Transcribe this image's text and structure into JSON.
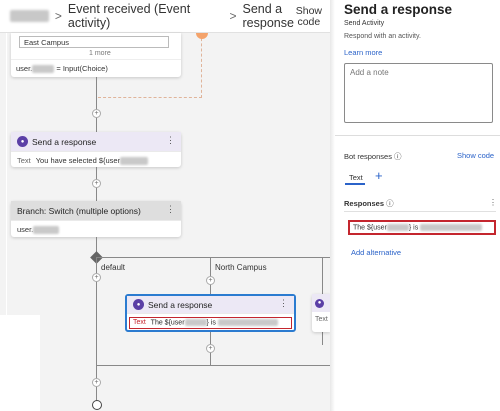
{
  "header": {
    "breadcrumb_current_dialog": "Event received (Event activity)",
    "breadcrumb_sep1": ">",
    "breadcrumb_sep2": ">",
    "breadcrumb_action": "Send a response",
    "show_code_line1": "Show",
    "show_code_line2": "code"
  },
  "canvas": {
    "choice_node": {
      "option_value": "East Campus",
      "more_label": "1 more",
      "assign_prefix": "user.",
      "assign_suffix": "= Input(Choice)"
    },
    "send_response_1": {
      "title": "Send a response",
      "menu": "⋮",
      "text_label": "Text",
      "text_value": "You have selected ${user"
    },
    "switch_node": {
      "title": "Branch: Switch (multiple options)",
      "menu": "⋮",
      "property_prefix": "user."
    },
    "branch_default": "default",
    "branch_north": "North Campus",
    "send_response_2": {
      "title": "Send a response",
      "menu": "⋮",
      "text_label": "Text",
      "text_value": "The ${user",
      "text_mid": "} is"
    },
    "partial_node": {
      "text_label": "Text"
    },
    "plus_symbol": "+"
  },
  "panel": {
    "title": "Send a response",
    "subtitle": "Send Activity",
    "description": "Respond with an activity.",
    "learn_more": "Learn more",
    "note_placeholder": "Add a note",
    "bot_responses_label": "Bot responses",
    "info_icon": "ⓘ",
    "show_code": "Show code",
    "tab_text": "Text",
    "tab_add": "+",
    "responses_label": "Responses",
    "responses_menu": "⋮",
    "response_prefix": "The ${user",
    "response_mid": "} is",
    "add_alternative": "Add alternative"
  },
  "colors": {
    "accent": "#2b63c9",
    "highlight_border": "#c4262e",
    "node_icon": "#5b3fa6",
    "selected_node_border": "#2b7bd0"
  }
}
